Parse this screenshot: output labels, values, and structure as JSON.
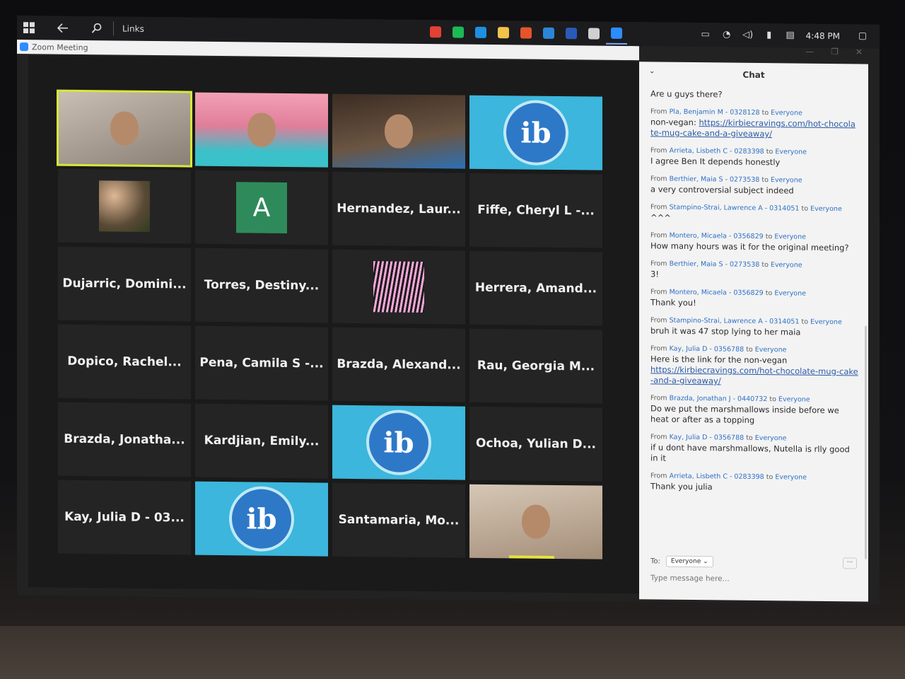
{
  "taskbar": {
    "links_label": "Links",
    "time": "4:48 PM",
    "apps": [
      {
        "icon": "chrome-icon",
        "color": "#e34133"
      },
      {
        "icon": "spotify-icon",
        "color": "#1db954"
      },
      {
        "icon": "edge-icon",
        "color": "#1f8fe0"
      },
      {
        "icon": "file-explorer-icon",
        "color": "#f2c24b"
      },
      {
        "icon": "office-icon",
        "color": "#e5542a"
      },
      {
        "icon": "mail-icon",
        "color": "#2b86d8"
      },
      {
        "icon": "word-icon",
        "color": "#2a5ab8"
      },
      {
        "icon": "settings-icon",
        "color": "#d0d0d0"
      },
      {
        "icon": "zoom-icon",
        "color": "#2d8cff"
      }
    ]
  },
  "window": {
    "title": "Zoom Meeting"
  },
  "tiles": [
    {
      "name": "",
      "type": "video"
    },
    {
      "name": "",
      "type": "video"
    },
    {
      "name": "",
      "type": "video"
    },
    {
      "name": "",
      "type": "ib"
    },
    {
      "name": "",
      "type": "image"
    },
    {
      "name": "A",
      "type": "avatar"
    },
    {
      "name": "Hernandez, Laur...",
      "type": "name"
    },
    {
      "name": "Fiffe, Cheryl L -...",
      "type": "name"
    },
    {
      "name": "Dujarric, Domini...",
      "type": "name"
    },
    {
      "name": "Torres, Destiny...",
      "type": "name"
    },
    {
      "name": "",
      "type": "stripes"
    },
    {
      "name": "Herrera, Amand...",
      "type": "name"
    },
    {
      "name": "Dopico, Rachel...",
      "type": "name"
    },
    {
      "name": "Pena, Camila S -...",
      "type": "name"
    },
    {
      "name": "Brazda, Alexand...",
      "type": "name"
    },
    {
      "name": "Rau, Georgia M...",
      "type": "name"
    },
    {
      "name": "Brazda, Jonatha...",
      "type": "name"
    },
    {
      "name": "Kardjian, Emily...",
      "type": "name"
    },
    {
      "name": "",
      "type": "ib"
    },
    {
      "name": "Ochoa, Yulian D...",
      "type": "name"
    },
    {
      "name": "Kay, Julia D - 03...",
      "type": "name"
    },
    {
      "name": "",
      "type": "ib"
    },
    {
      "name": "Santamaria, Mo...",
      "type": "name"
    },
    {
      "name": "",
      "type": "video"
    }
  ],
  "ib_logo_letters": "ib",
  "chat": {
    "title": "Chat",
    "first_message": "Are u guys there?",
    "messages": [
      {
        "from": "Pla, Benjamin M - 0328128",
        "to": "Everyone",
        "text": "non-vegan: ",
        "link": "https://kirbiecravings.com/hot-chocolate-mug-cake-and-a-giveaway/"
      },
      {
        "from": "Arrieta, Lisbeth C - 0283398",
        "to": "Everyone",
        "text": "I agree Ben It depends honestly",
        "link": ""
      },
      {
        "from": "Berthier, Maia S - 0273538",
        "to": "Everyone",
        "text": "a very controversial subject indeed",
        "link": ""
      },
      {
        "from": "Stampino-Strai, Lawrence A - 0314051",
        "to": "Everyone",
        "text": "^^^",
        "link": ""
      },
      {
        "from": "Montero, Micaela - 0356829",
        "to": "Everyone",
        "text": "How many hours was it for the original meeting?",
        "link": ""
      },
      {
        "from": "Berthier, Maia S - 0273538",
        "to": "Everyone",
        "text": "3!",
        "link": ""
      },
      {
        "from": "Montero, Micaela - 0356829",
        "to": "Everyone",
        "text": "Thank you!",
        "link": ""
      },
      {
        "from": "Stampino-Strai, Lawrence A - 0314051",
        "to": "Everyone",
        "text": "bruh it was 47 stop lying to her maia",
        "link": ""
      },
      {
        "from": "Kay, Julia D - 0356788",
        "to": "Everyone",
        "text": "Here is the link for the non-vegan",
        "link": "https://kirbiecravings.com/hot-chocolate-mug-cake-and-a-giveaway/"
      },
      {
        "from": "Brazda, Jonathan J - 0440732",
        "to": "Everyone",
        "text": "Do we put the marshmallows inside before we heat or after as a topping",
        "link": ""
      },
      {
        "from": "Kay, Julia D - 0356788",
        "to": "Everyone",
        "text": "if u dont have marshmallows, Nutella is rlly good in it",
        "link": ""
      },
      {
        "from": "Arrieta, Lisbeth C - 0283398",
        "to": "Everyone",
        "text": "Thank you julia",
        "link": ""
      }
    ],
    "from_label": "From",
    "to_label": "to",
    "recipient_label": "To:",
    "recipient_value": "Everyone",
    "input_placeholder": "Type message here..."
  }
}
